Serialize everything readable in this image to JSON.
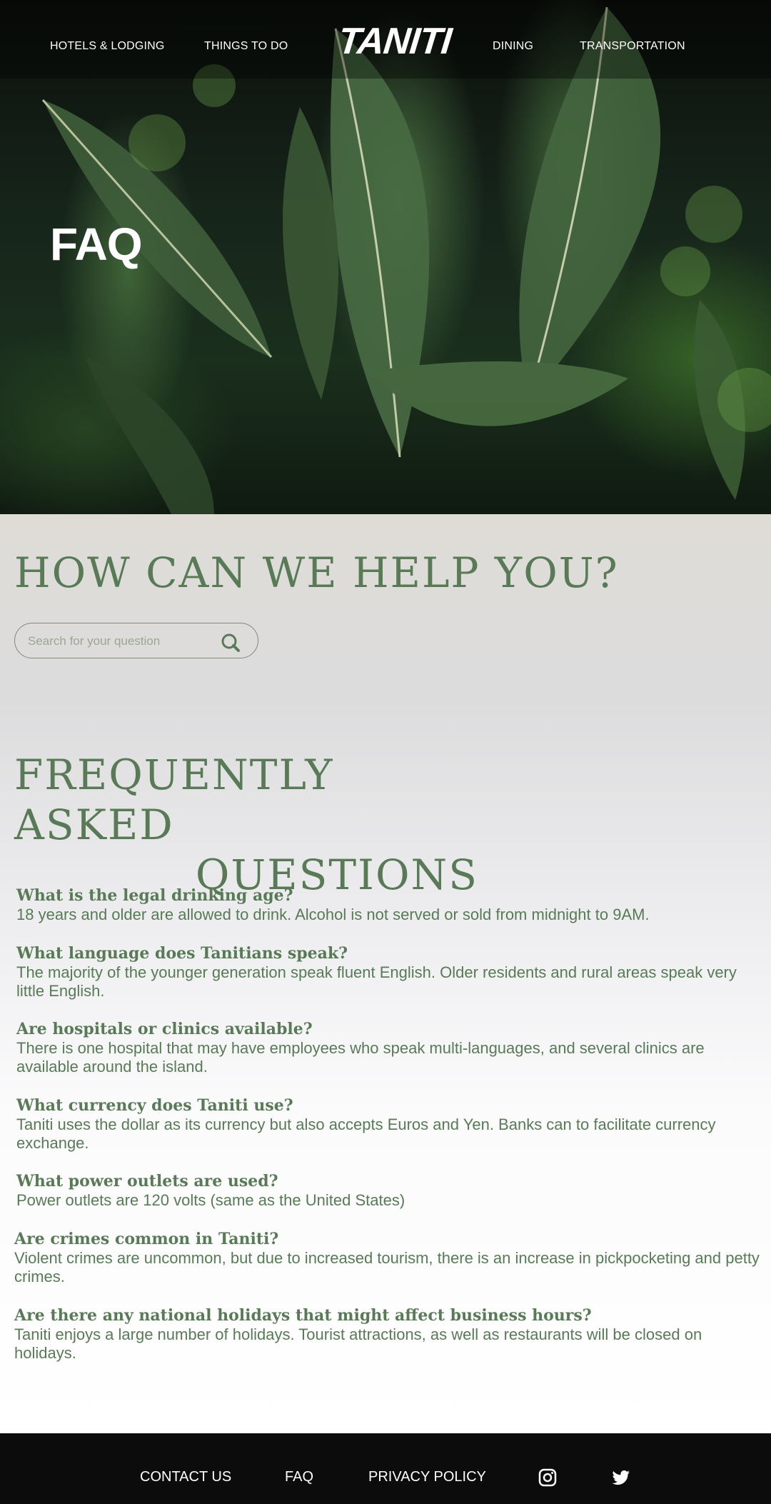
{
  "nav": {
    "items": [
      "HOTELS & LODGING",
      "THINGS TO DO",
      "DINING",
      "TRANSPORTATION"
    ],
    "logo": "TANITI"
  },
  "hero": {
    "title": "FAQ"
  },
  "help": {
    "title": "HOW CAN WE HELP YOU?",
    "search_placeholder": "Search for your question",
    "search_value": ""
  },
  "faq": {
    "title_line1": "FREQUENTLY ASKED",
    "title_line2": "QUESTIONS",
    "items": [
      {
        "q": "What is the legal drinking age?",
        "a": "18 years and older are allowed to drink. Alcohol is not served or sold from midnight to 9AM."
      },
      {
        "q": "What language does Tanitians speak?",
        "a": "The majority of the younger generation speak fluent English. Older residents and rural areas speak very little English."
      },
      {
        "q": "Are hospitals or clinics available?",
        "a": "There is one hospital that may have employees who speak multi-languages, and several clinics are available around the island."
      },
      {
        "q": "What currency does Taniti use?",
        "a": "Taniti uses the dollar as its currency but also accepts Euros and Yen. Banks can to facilitate currency exchange."
      },
      {
        "q": "What power outlets are used?",
        "a": "Power outlets are 120 volts (same as the United States)"
      },
      {
        "q": "Are crimes common in Taniti?",
        "a": "Violent crimes are uncommon, but due to increased tourism, there is an increase in pickpocketing and petty crimes."
      },
      {
        "q": "Are there any national holidays that might affect business hours?",
        "a": "Taniti enjoys a large number of holidays. Tourist attractions, as well as restaurants will be closed on holidays."
      }
    ]
  },
  "footer": {
    "links": [
      "CONTACT US",
      "FAQ",
      "PRIVACY POLICY"
    ],
    "social_icons": [
      "instagram-icon",
      "twitter-icon"
    ]
  },
  "colors": {
    "accent": "#587a56",
    "footer_bg": "#0b0c0b",
    "nav_text": "#ffffff"
  }
}
